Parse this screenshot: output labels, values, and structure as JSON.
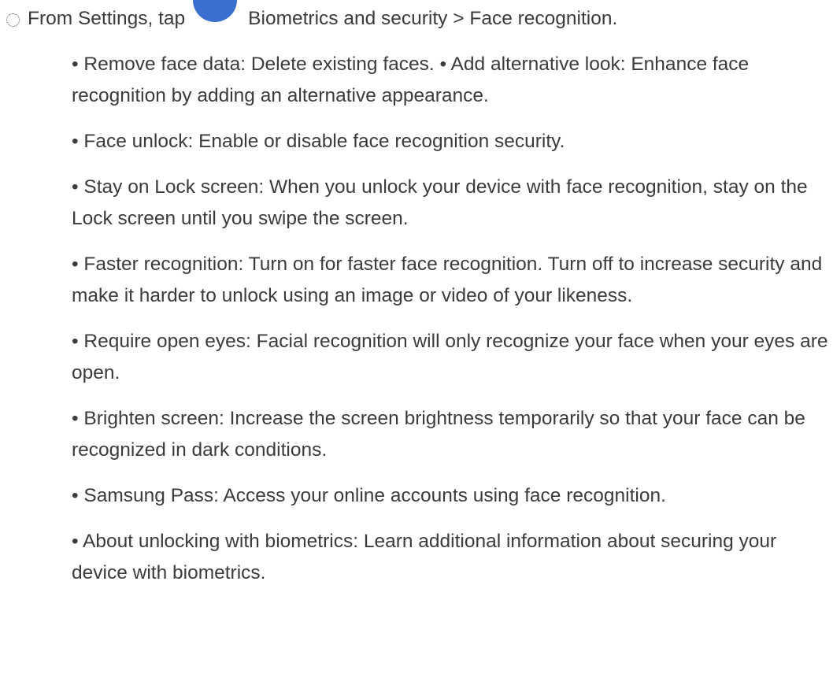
{
  "step": {
    "marker_icon": "dotted-circle-icon",
    "text_before": "From Settings, tap",
    "settings_icon": "settings-app-icon",
    "settings_icon_color": "#3a6fd0",
    "text_after": "Biometrics and security > Face recognition."
  },
  "options": [
    "• Remove face data: Delete existing faces. • Add alternative look: Enhance face recognition by adding an alternative appearance.",
    "• Face unlock: Enable or disable face recognition security.",
    "• Stay on Lock screen: When you unlock your device with face recognition, stay on the Lock screen until you swipe the screen.",
    "• Faster recognition: Turn on for faster face recognition. Turn off to increase security and make it harder to unlock using an image or video of your likeness.",
    "• Require open eyes: Facial recognition will only recognize your face when your eyes are open.",
    "• Brighten screen: Increase the screen brightness temporarily so that your face can be recognized in dark conditions.",
    "• Samsung Pass: Access your online accounts using face recognition.",
    "• About unlocking with biometrics: Learn additional information about securing your device with biometrics."
  ]
}
